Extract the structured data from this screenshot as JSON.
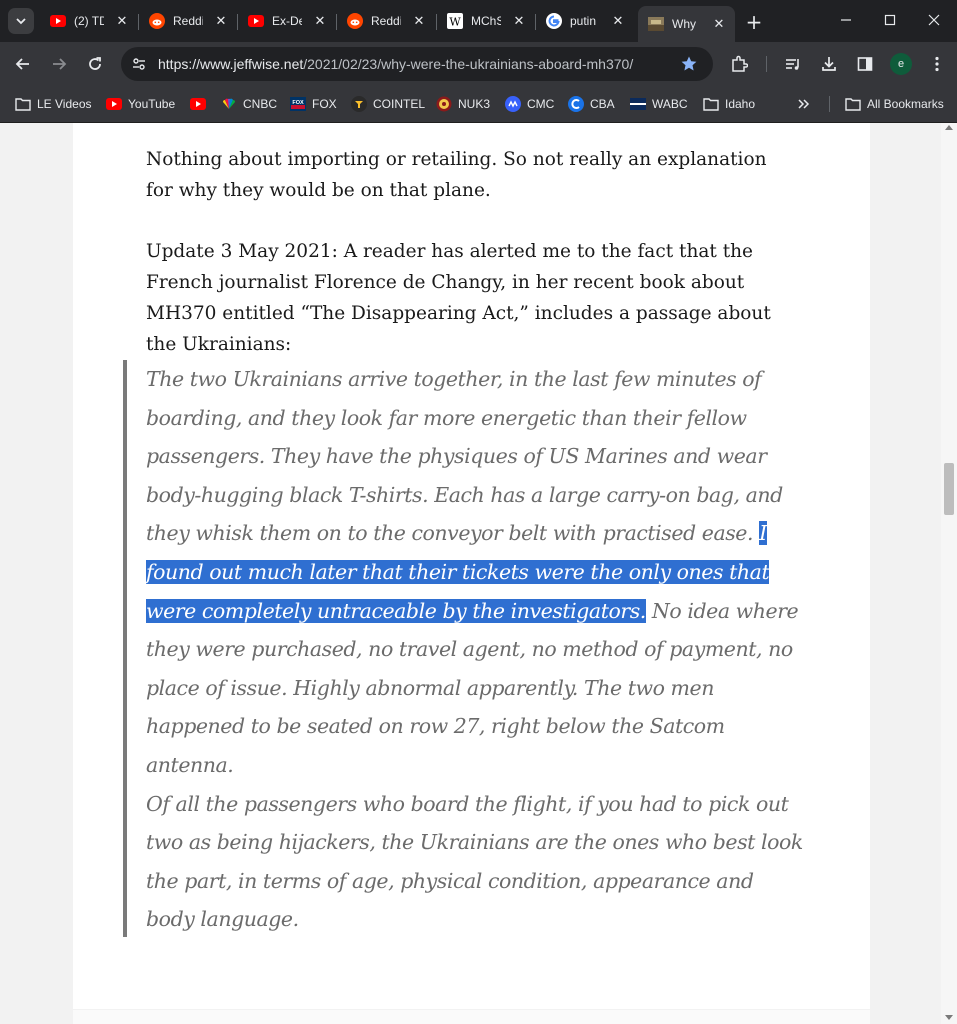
{
  "tabs": [
    {
      "title": "(2) TD",
      "icon": "youtube-icon"
    },
    {
      "title": "Reddit",
      "icon": "reddit-icon"
    },
    {
      "title": "Ex-De",
      "icon": "youtube-icon"
    },
    {
      "title": "Reddit",
      "icon": "reddit-icon"
    },
    {
      "title": "MChS",
      "icon": "wikipedia-icon"
    },
    {
      "title": "putin",
      "icon": "google-icon"
    },
    {
      "title": "Why",
      "icon": "jeffwise-icon",
      "active": true
    }
  ],
  "toolbar": {
    "url_host": "https://www.jeffwise.net",
    "url_path": "/2021/02/23/why-were-the-ukrainians-aboard-mh370/",
    "profile_initial": "e"
  },
  "bookmarks": [
    {
      "label": "LE Videos",
      "icon": "folder-icon"
    },
    {
      "label": "YouTube",
      "icon": "youtube-icon"
    },
    {
      "label": "",
      "icon": "youtube-icon"
    },
    {
      "label": "CNBC",
      "icon": "cnbc-icon"
    },
    {
      "label": "FOX",
      "icon": "fox-news-icon"
    },
    {
      "label": "COINTEL",
      "icon": "cointelegraph-icon"
    },
    {
      "label": "NUK3",
      "icon": "nuk3-icon"
    },
    {
      "label": "CMC",
      "icon": "coinmarketcap-icon"
    },
    {
      "label": "CBA",
      "icon": "cba-icon"
    },
    {
      "label": "WABC",
      "icon": "wabc-icon"
    },
    {
      "label": "Idaho",
      "icon": "folder-icon"
    }
  ],
  "all_bookmarks_label": "All Bookmarks",
  "article": {
    "para1": "Nothing about importing or retailing. So not really an explanation for why they would be on that plane.",
    "para2": "Update 3 May 2021: A reader has alerted me to the fact that the French journalist Florence de Changy, in her recent book about MH370 entitled “The Disappearing Act,” includes a passage about the Ukrainians:",
    "quote_before": "The two Ukrainians arrive together, in the last few minutes of boarding, and they look far more energetic than their fellow passengers. They have the physiques of US Marines and wear body-hugging black T-shirts. Each has a large carry-on bag, and they whisk them on to the conveyor belt with practised ease. ",
    "quote_highlight": "I found out much later that their tickets were the only ones that were completely untraceable by the investigators.",
    "quote_after": " No idea where they were purchased, no travel agent, no method of payment, no place of issue. Highly abnormal apparently. The two men happened to be seated on row 27, right below the Satcom antenna.",
    "quote_para2": "Of all the passengers who board the flight, if you had to pick out two as being hijackers, the Ukrainians are the ones who best look the part, in terms of age, physical condition, appearance and body language."
  },
  "colors": {
    "selection": "#2f6fd1",
    "quote_text": "#6b6b6b",
    "chrome_dark": "#202124",
    "chrome_toolbar": "#35363a"
  }
}
